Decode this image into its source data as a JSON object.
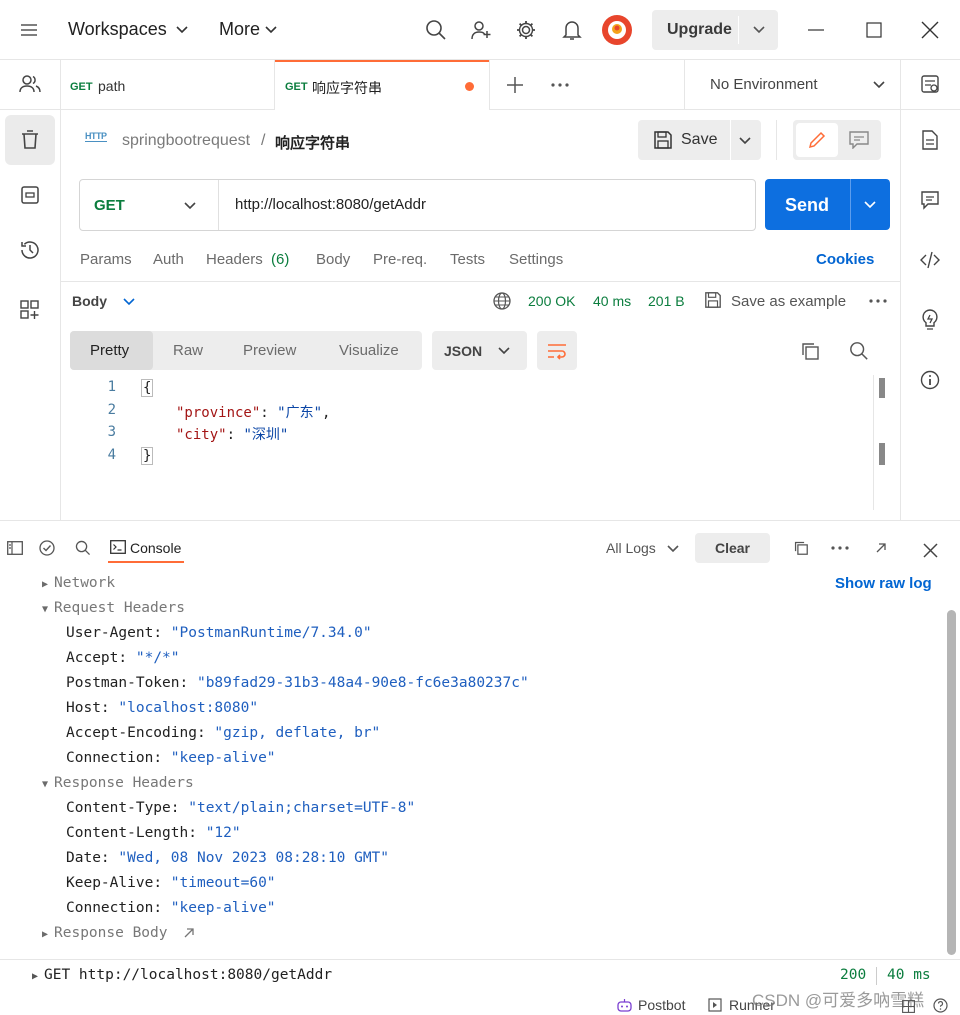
{
  "topbar": {
    "workspaces_label": "Workspaces",
    "more_label": "More",
    "upgrade_label": "Upgrade"
  },
  "tabs": [
    {
      "method": "GET",
      "name": "path"
    },
    {
      "method": "GET",
      "name": "响应字符串"
    }
  ],
  "environment": {
    "selected": "No Environment"
  },
  "breadcrumb": {
    "collection": "springbootrequest",
    "separator": "/",
    "request": "响应字符串",
    "http_badge": "HTTP"
  },
  "save_label": "Save",
  "request": {
    "method": "GET",
    "url": "http://localhost:8080/getAddr",
    "send_label": "Send"
  },
  "request_tabs": {
    "params": "Params",
    "auth": "Auth",
    "headers": "Headers",
    "headers_count": "(6)",
    "body": "Body",
    "prereq": "Pre-req.",
    "tests": "Tests",
    "settings": "Settings",
    "cookies": "Cookies"
  },
  "response": {
    "body_label": "Body",
    "status": "200 OK",
    "time": "40 ms",
    "size": "201 B",
    "save_example": "Save as example",
    "view_tabs": [
      "Pretty",
      "Raw",
      "Preview",
      "Visualize"
    ],
    "format": "JSON",
    "lines": [
      {
        "n": "1",
        "text": "{"
      },
      {
        "n": "2",
        "key": "\"province\"",
        "colon": ": ",
        "val": "\"广东\"",
        "tail": ","
      },
      {
        "n": "3",
        "key": "\"city\"",
        "colon": ": ",
        "val": "\"深圳\"",
        "tail": ""
      },
      {
        "n": "4",
        "text": "}"
      }
    ]
  },
  "console": {
    "tab_label": "Console",
    "filter_label": "All Logs",
    "clear_label": "Clear",
    "show_raw_log": "Show raw log",
    "network": "Network",
    "request_headers_title": "Request Headers",
    "request_headers": [
      {
        "k": "User-Agent",
        "v": "\"PostmanRuntime/7.34.0\""
      },
      {
        "k": "Accept",
        "v": "\"*/*\""
      },
      {
        "k": "Postman-Token",
        "v": "\"b89fad29-31b3-48a4-90e8-fc6e3a80237c\""
      },
      {
        "k": "Host",
        "v": "\"localhost:8080\""
      },
      {
        "k": "Accept-Encoding",
        "v": "\"gzip, deflate, br\""
      },
      {
        "k": "Connection",
        "v": "\"keep-alive\""
      }
    ],
    "response_headers_title": "Response Headers",
    "response_headers": [
      {
        "k": "Content-Type",
        "v": "\"text/plain;charset=UTF-8\""
      },
      {
        "k": "Content-Length",
        "v": "\"12\""
      },
      {
        "k": "Date",
        "v": "\"Wed, 08 Nov 2023 08:28:10 GMT\""
      },
      {
        "k": "Keep-Alive",
        "v": "\"timeout=60\""
      },
      {
        "k": "Connection",
        "v": "\"keep-alive\""
      }
    ],
    "response_body": "Response Body",
    "entry": {
      "request": "GET http://localhost:8080/getAddr",
      "status": "200",
      "time": "40 ms"
    }
  },
  "footer": {
    "postbot": "Postbot",
    "runner": "Runner",
    "watermark": "CSDN @可爱多吶雪糕"
  },
  "colors": {
    "accent_blue": "#0265d2",
    "send_blue": "#0d6fe0",
    "orange": "#ff6c37",
    "green": "#0b7d3e"
  }
}
